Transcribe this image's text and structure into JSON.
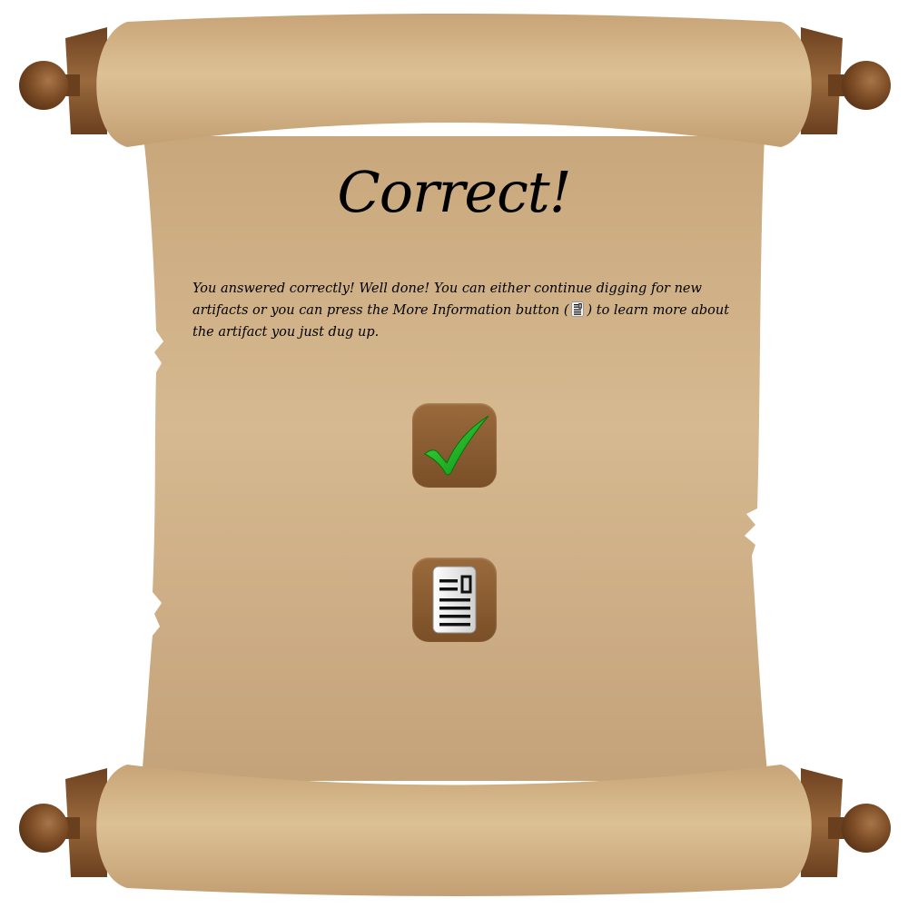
{
  "popup": {
    "title": "Correct!",
    "message_before_icon": "You answered correctly! Well done! You can either continue digging for new artifacts or you can press the More Information button (",
    "message_after_icon": ") to learn more about the artifact you just dug up."
  },
  "buttons": {
    "continue_icon": "checkmark-icon",
    "info_icon": "document-icon"
  },
  "colors": {
    "parchment": "#d1b288",
    "roller_wood": "#7a4a24",
    "button_brown": "#8b5e34",
    "check_green": "#1fb81f"
  }
}
